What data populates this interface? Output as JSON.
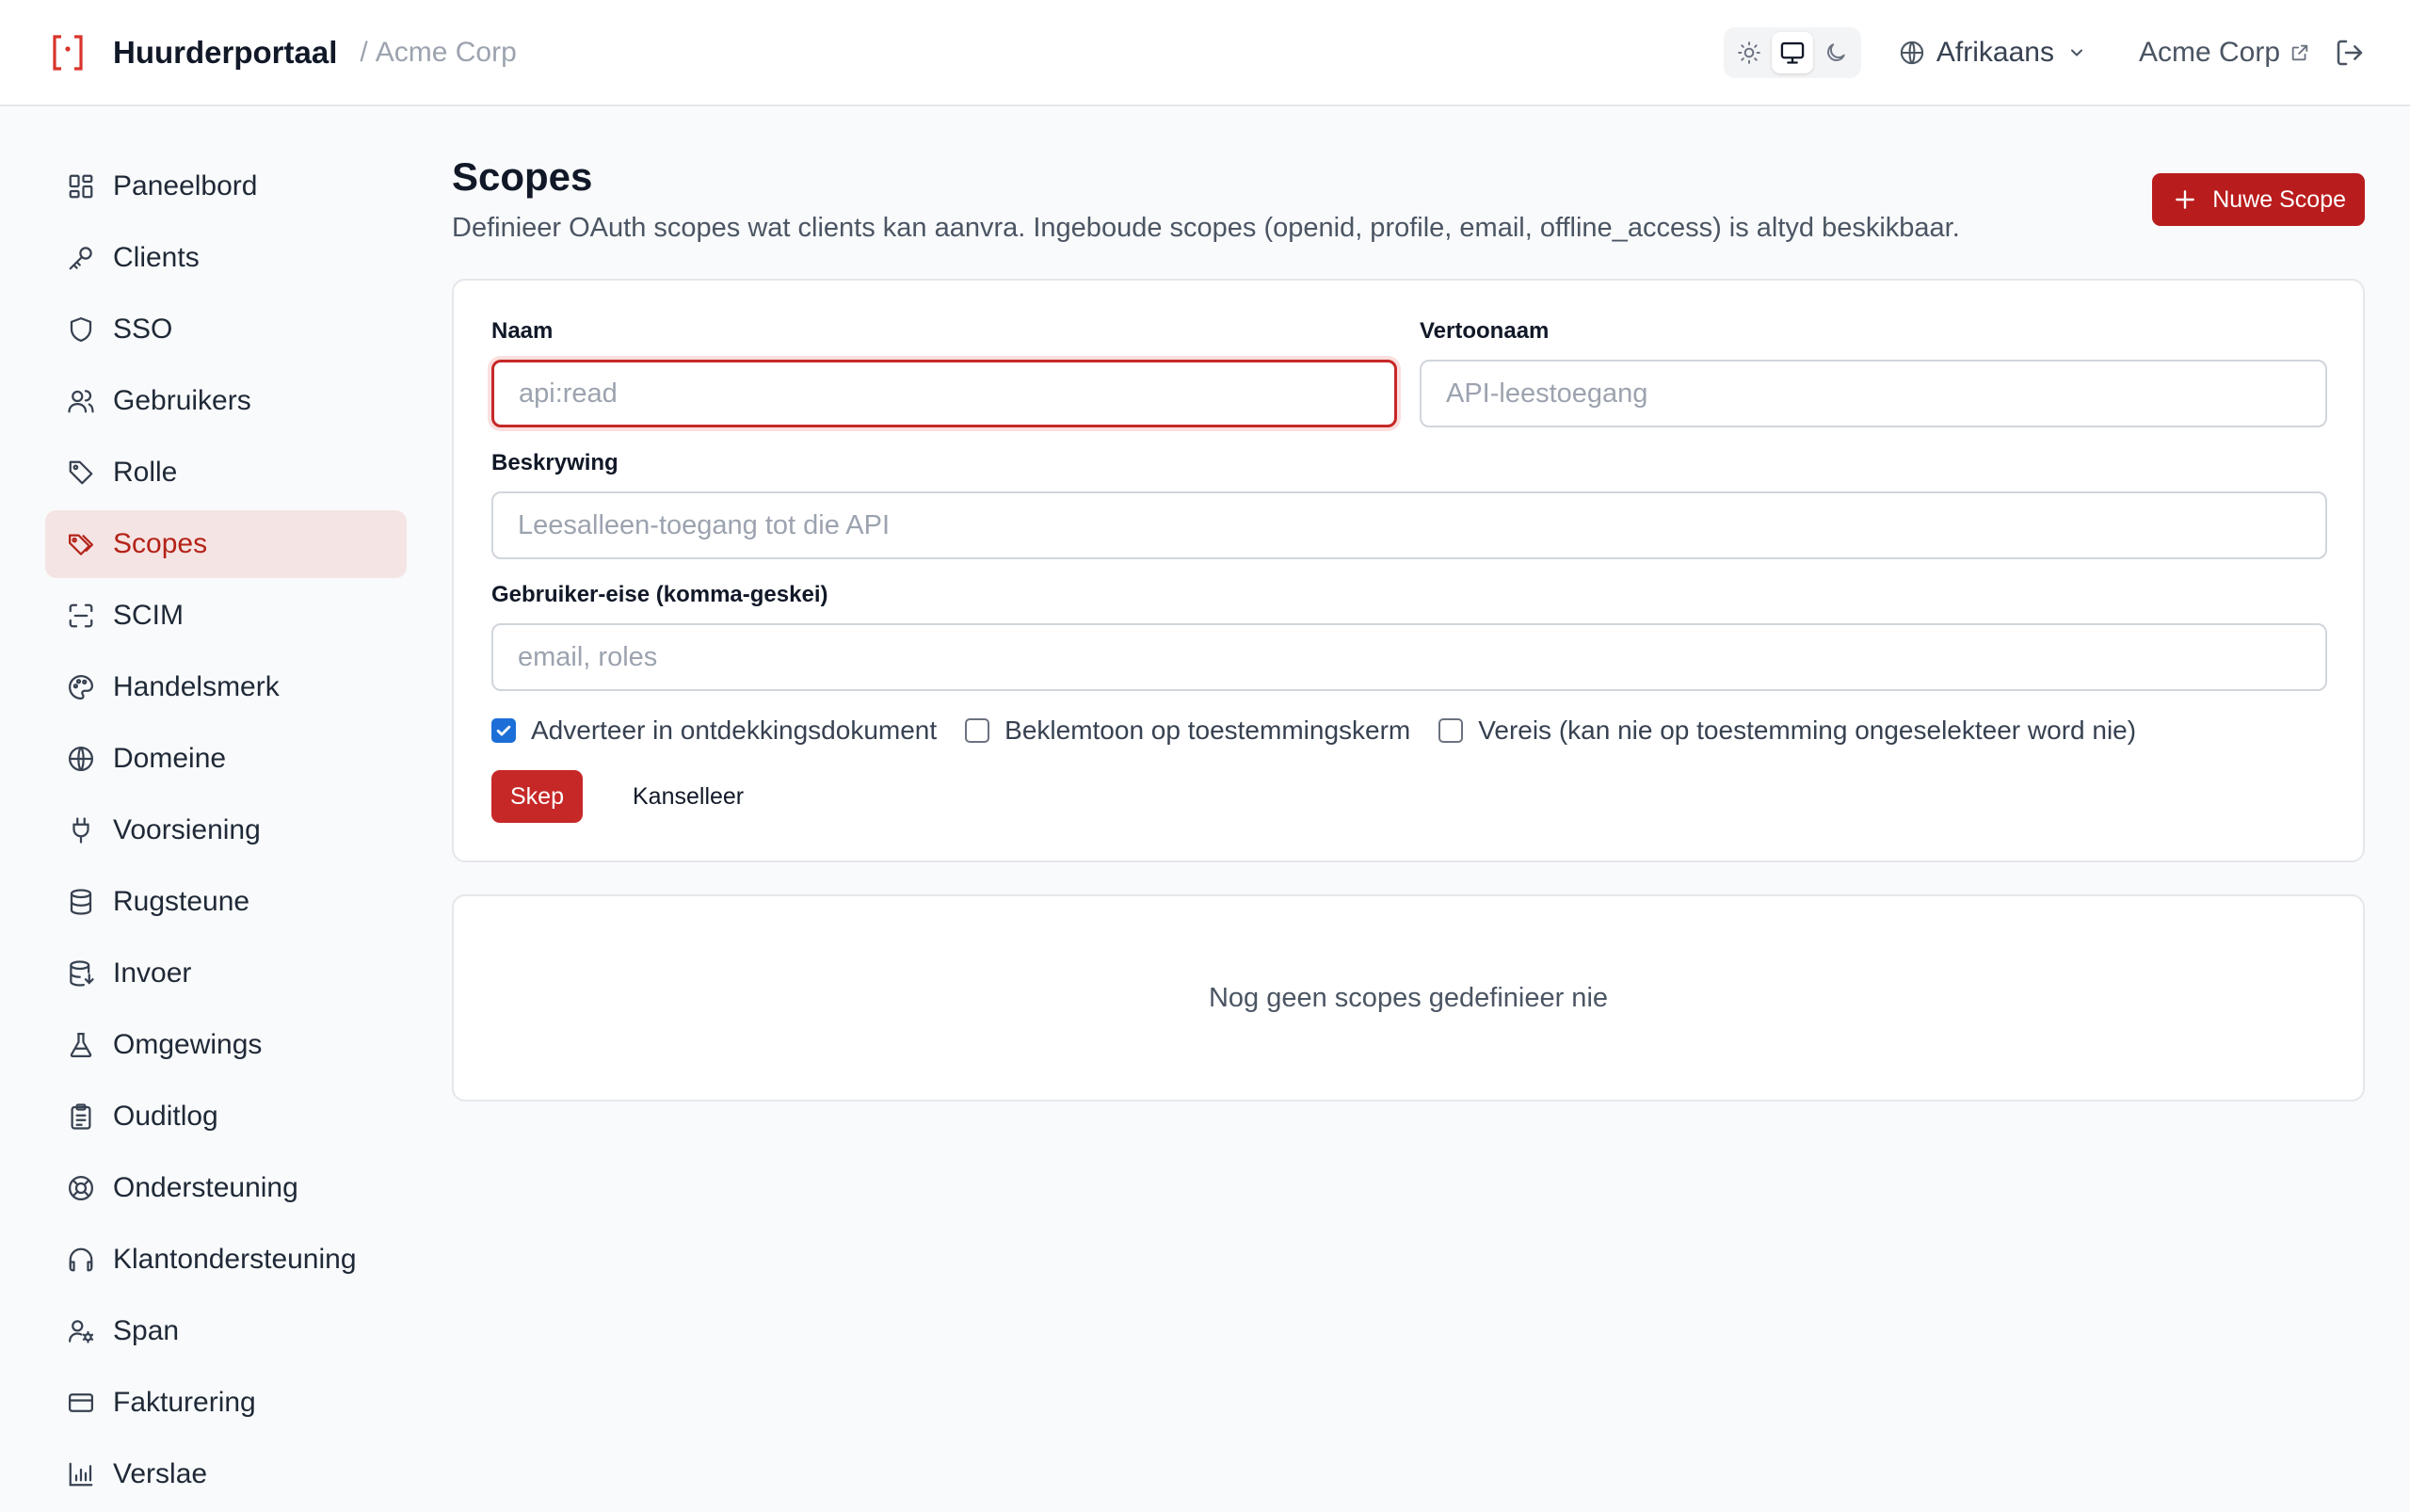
{
  "header": {
    "brand_title": "Huurderportaal",
    "separator": "/",
    "org_name": "Acme Corp",
    "language": "Afrikaans",
    "org_link": "Acme Corp"
  },
  "sidebar": {
    "items": [
      {
        "label": "Paneelbord",
        "icon": "dashboard-icon"
      },
      {
        "label": "Clients",
        "icon": "key-icon"
      },
      {
        "label": "SSO",
        "icon": "shield-icon"
      },
      {
        "label": "Gebruikers",
        "icon": "users-icon"
      },
      {
        "label": "Rolle",
        "icon": "tag-icon"
      },
      {
        "label": "Scopes",
        "icon": "tags-icon",
        "active": true
      },
      {
        "label": "SCIM",
        "icon": "scan-icon"
      },
      {
        "label": "Handelsmerk",
        "icon": "palette-icon"
      },
      {
        "label": "Domeine",
        "icon": "globe-icon"
      },
      {
        "label": "Voorsiening",
        "icon": "plug-icon"
      },
      {
        "label": "Rugsteune",
        "icon": "database-icon"
      },
      {
        "label": "Invoer",
        "icon": "database-import-icon"
      },
      {
        "label": "Omgewings",
        "icon": "flask-icon"
      },
      {
        "label": "Ouditlog",
        "icon": "clipboard-icon"
      },
      {
        "label": "Ondersteuning",
        "icon": "lifebuoy-icon"
      },
      {
        "label": "Klantondersteuning",
        "icon": "headphones-icon"
      },
      {
        "label": "Span",
        "icon": "user-cog-icon"
      },
      {
        "label": "Fakturering",
        "icon": "credit-card-icon"
      },
      {
        "label": "Verslae",
        "icon": "bar-chart-icon"
      }
    ]
  },
  "main": {
    "title": "Scopes",
    "description": "Definieer OAuth scopes wat clients kan aanvra. Ingeboude scopes (openid, profile, email, offline_access) is altyd beskikbaar.",
    "new_button": "Nuwe Scope",
    "form": {
      "name_label": "Naam",
      "name_placeholder": "api:read",
      "display_label": "Vertoonaam",
      "display_placeholder": "API-leestoegang",
      "description_label": "Beskrywing",
      "description_placeholder": "Leesalleen-toegang tot die API",
      "claims_label": "Gebruiker-eise (komma-geskei)",
      "claims_placeholder": "email, roles",
      "check_advertise": "Adverteer in ontdekkingsdokument",
      "check_emphasize": "Beklemtoon op toestemmingskerm",
      "check_required": "Vereis (kan nie op toestemming ongeselekteer word nie)",
      "create_button": "Skep",
      "cancel_button": "Kanselleer"
    },
    "empty_state": "Nog geen scopes gedefinieer nie"
  },
  "colors": {
    "accent": "#b91c1c",
    "active_bg": "#f5e4e4",
    "active_text": "#b42318",
    "checkbox": "#1d6fd8"
  }
}
